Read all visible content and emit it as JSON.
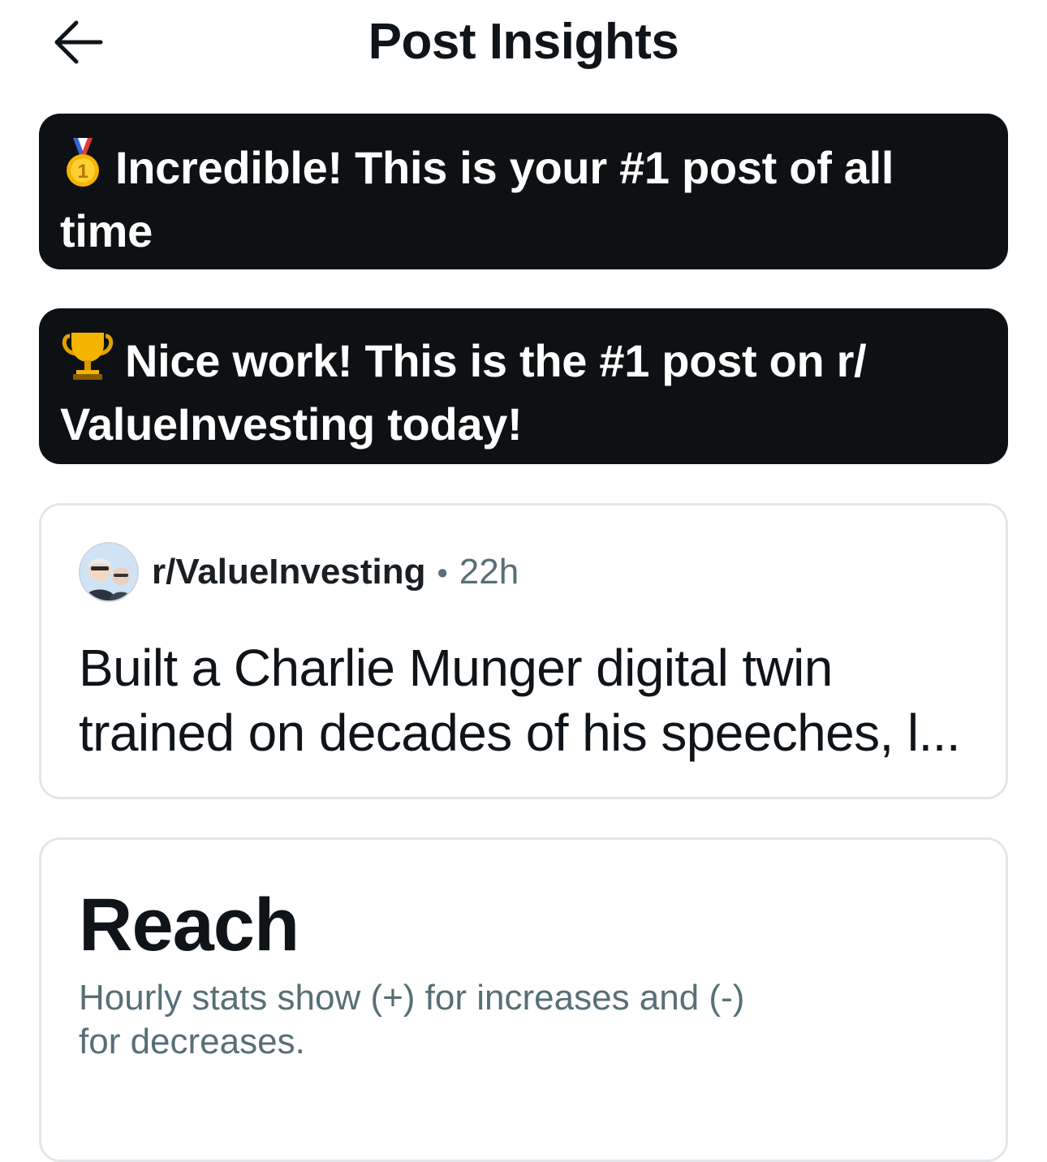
{
  "header": {
    "title": "Post Insights",
    "back_icon": "arrow-left-icon"
  },
  "banners": [
    {
      "icon": "first-place-medal-icon",
      "text": "Incredible! This is your #1 post of all time"
    },
    {
      "icon": "trophy-icon",
      "text": "Nice work! This is the #1 post on r/ ValueInvesting today!"
    }
  ],
  "post": {
    "subreddit": "r/ValueInvesting",
    "separator": "•",
    "age": "22h",
    "title_line1": "Built a Charlie Munger digital twin",
    "title_line2": "trained on decades of his speeches, l..."
  },
  "reach": {
    "title": "Reach",
    "subtitle_line1": "Hourly stats show (+) for increases and (-)",
    "subtitle_line2": "for decreases."
  },
  "colors": {
    "banner_bg": "#0e1113",
    "muted_text": "#576f76",
    "card_border": "#e3e6e8"
  }
}
